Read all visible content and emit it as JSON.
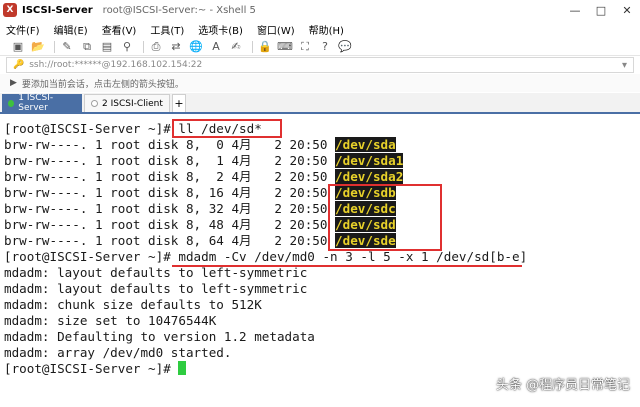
{
  "window": {
    "host_label": "ISCSI-Server",
    "title_rest": "root@ISCSI-Server:~ - Xshell 5",
    "controls": [
      "minimize-icon",
      "maximize-icon",
      "close-icon"
    ]
  },
  "menu": {
    "items": [
      "文件(F)",
      "编辑(E)",
      "查看(V)",
      "工具(T)",
      "选项卡(B)",
      "窗口(W)",
      "帮助(H)"
    ]
  },
  "toolbar": {
    "icons": [
      "new-session-icon",
      "open-folder-icon",
      "link-icon",
      "copy-icon",
      "paste-icon",
      "find-icon",
      "print-icon",
      "transfer-icon",
      "globe-icon",
      "font-icon",
      "compose-icon",
      "lock-icon",
      "keyboard-icon",
      "fullscreen-icon",
      "help-icon",
      "chat-icon"
    ]
  },
  "address": {
    "text": "ssh://root:******@192.168.102.154:22"
  },
  "hint": {
    "text": "要添加当前会话，点击左侧的箭头按钮。"
  },
  "tabs": [
    {
      "label": "1 ISCSI-Server",
      "active": true
    },
    {
      "label": "2 ISCSI-Client",
      "active": false
    }
  ],
  "terminal": {
    "prompt": "[root@ISCSI-Server ~]# ",
    "command1": "ll /dev/sd*",
    "rows": [
      {
        "prefix": "brw-rw----. 1 root disk 8,  0 4月   2 20:50 ",
        "name": "/dev/sda"
      },
      {
        "prefix": "brw-rw----. 1 root disk 8,  1 4月   2 20:50 ",
        "name": "/dev/sda1"
      },
      {
        "prefix": "brw-rw----. 1 root disk 8,  2 4月   2 20:50 ",
        "name": "/dev/sda2"
      },
      {
        "prefix": "brw-rw----. 1 root disk 8, 16 4月   2 20:50 ",
        "name": "/dev/sdb"
      },
      {
        "prefix": "brw-rw----. 1 root disk 8, 32 4月   2 20:50 ",
        "name": "/dev/sdc"
      },
      {
        "prefix": "brw-rw----. 1 root disk 8, 48 4月   2 20:50 ",
        "name": "/dev/sdd"
      },
      {
        "prefix": "brw-rw----. 1 root disk 8, 64 4月   2 20:50 ",
        "name": "/dev/sde"
      }
    ],
    "command2": "mdadm -Cv /dev/md0 -n 3 -l 5 -x 1 /dev/sd[b-e]",
    "output": [
      "mdadm: layout defaults to left-symmetric",
      "mdadm: layout defaults to left-symmetric",
      "mdadm: chunk size defaults to 512K",
      "mdadm: size set to 10476544K",
      "mdadm: Defaulting to version 1.2 metadata",
      "mdadm: array /dev/md0 started."
    ],
    "final_prompt": "[root@ISCSI-Server ~]# "
  },
  "watermark": "头条 @程序员日常笔记",
  "colors": {
    "highlight_fg": "#e8d12a",
    "highlight_bg": "#1a1a1a",
    "annotation": "#e03030",
    "cursor": "#2ecc40",
    "tab_active": "#4a6fa5"
  }
}
